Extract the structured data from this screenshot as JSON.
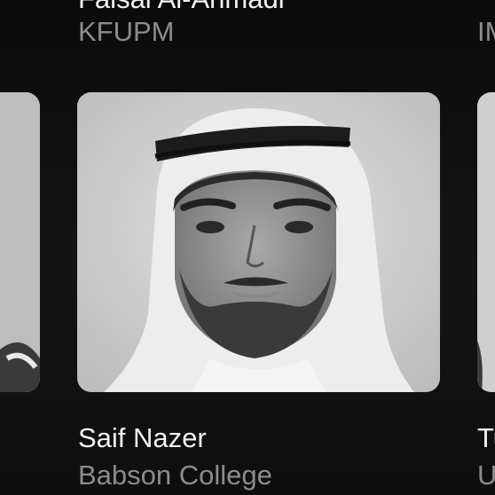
{
  "carousel": {
    "top_row": [
      {
        "name": "Faisal Al-Ahmadi",
        "org": "KFUPM"
      },
      {
        "name": "",
        "org": "IM"
      }
    ],
    "bottom_row": [
      {
        "name": "Saif Nazer",
        "org": "Babson College"
      },
      {
        "name": "Tu",
        "org": "U"
      }
    ]
  },
  "colors": {
    "background": "#111111",
    "name_text": "#f2f2f2",
    "org_text": "#8c8c8c"
  }
}
